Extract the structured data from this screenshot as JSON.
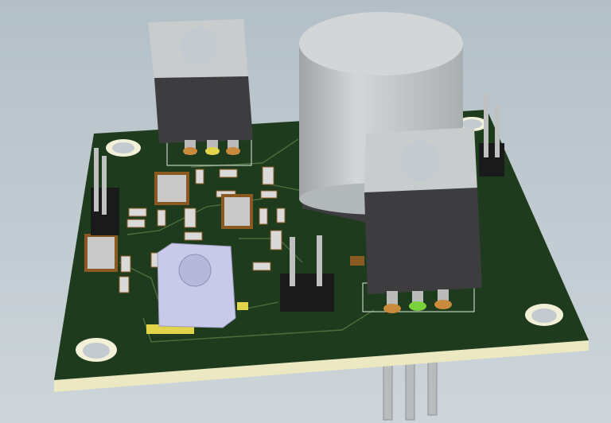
{
  "scene": {
    "subject": "pcb-3d-view",
    "colors": {
      "background_top": "#b3bfc7",
      "background_bottom": "#cdd5da",
      "board": "#1f3b1d",
      "board_edge": "#ebe8c2",
      "trace": "#4a6a3a",
      "metal_tab": "#c9cccd",
      "component_body": "#3d3d3f",
      "capacitor": "#c4c8c9",
      "header": "#1a1a1a",
      "pin": "#c0c0c0",
      "potentiometer": "#c9c9ea",
      "pad": "#c98a3c",
      "green_pad": "#7ad23a",
      "inductor": "#8a5a22"
    },
    "icons": [
      "mounting-hole-icon",
      "regulator-icon",
      "capacitor-icon",
      "pin-header-icon",
      "potentiometer-icon"
    ]
  }
}
